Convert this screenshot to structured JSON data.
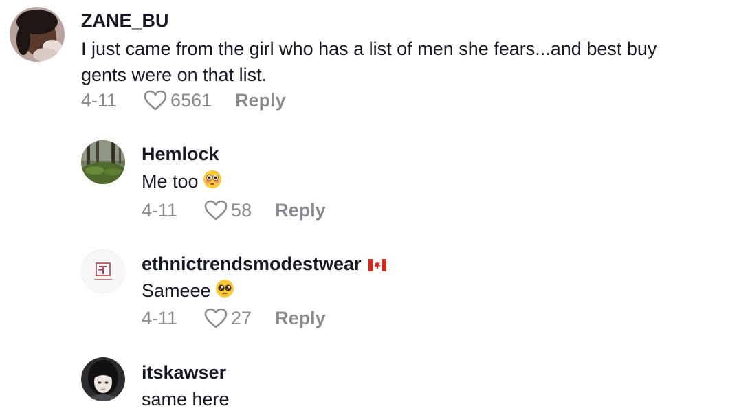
{
  "comments": [
    {
      "username": "ZANE_BU",
      "text_line1": "I just came from the girl who has a list of men she fears...and best buy",
      "text_line2": "gents were on that list.",
      "date": "4-11",
      "likes": "6561",
      "reply_label": "Reply"
    },
    {
      "username": "Hemlock",
      "text": "Me too",
      "emoji": "flushed-face",
      "date": "4-11",
      "likes": "58",
      "reply_label": "Reply"
    },
    {
      "username": "ethnictrendsmodestwear",
      "badge": "canada-flag",
      "text": "Sameee",
      "emoji": "pleading-face",
      "date": "4-11",
      "likes": "27",
      "reply_label": "Reply"
    },
    {
      "username": "itskawser",
      "text": "same here"
    }
  ],
  "icons": {
    "like": "heart-outline-icon"
  },
  "colors": {
    "text": "#161823",
    "secondary": "#8a8b91",
    "background": "#ffffff",
    "flag_red": "#d52b1e"
  }
}
